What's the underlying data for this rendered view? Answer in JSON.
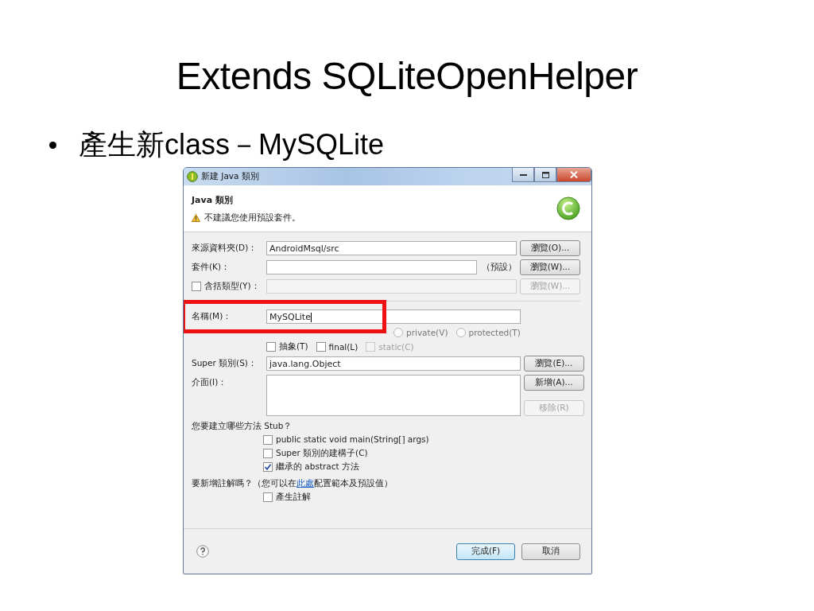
{
  "slide": {
    "title": "Extends SQLiteOpenHelper",
    "bullets": [
      "產生新class－MySQLite"
    ]
  },
  "dialog": {
    "title": "新建 Java 類別",
    "header": {
      "title": "Java 類別",
      "message": "不建議您使用預設套件。"
    },
    "source_folder": {
      "label": "來源資料夾(D)：",
      "value": "AndroidMsql/src",
      "button": {
        "label": "瀏覽(O)...",
        "disabled": false
      }
    },
    "package": {
      "label": "套件(K)：",
      "suffix": "（預設）",
      "button": {
        "label": "瀏覽(W)...",
        "disabled": false
      }
    },
    "enclosing_type": {
      "label": "含括類型(Y)：",
      "checked": false,
      "disabled": true,
      "button": {
        "label": "瀏覽(W)...",
        "disabled": true
      }
    },
    "name": {
      "label": "名稱(M)：",
      "value": "MySQLite",
      "highlighted": true
    },
    "modifier_radios": [
      {
        "label": "private(V)",
        "selected": false
      },
      {
        "label": "protected(T)",
        "selected": false
      }
    ],
    "modifier_checks": [
      {
        "label": "抽象(T)",
        "checked": false,
        "disabled": false
      },
      {
        "label": "final(L)",
        "checked": false,
        "disabled": false
      },
      {
        "label": "static(C)",
        "checked": false,
        "disabled": true
      }
    ],
    "superclass": {
      "label": "Super 類別(S)：",
      "value": "java.lang.Object",
      "button": {
        "label": "瀏覽(E)...",
        "disabled": false
      }
    },
    "interfaces": {
      "label": "介面(I)：",
      "buttons": [
        {
          "label": "新增(A)...",
          "disabled": false
        },
        {
          "label": "移除(R)",
          "disabled": true
        }
      ]
    },
    "stubs": {
      "question": "您要建立哪些方法 Stub？",
      "options": [
        {
          "label": "public static void main(String[] args)",
          "checked": false
        },
        {
          "label": "Super 類別的建構子(C)",
          "checked": false
        },
        {
          "label": "繼承的 abstract 方法",
          "checked": true
        }
      ]
    },
    "comments": {
      "before": "要新增註解嗎？（您可以在",
      "link": "此處",
      "after": "配置範本及預設值）",
      "options": [
        {
          "label": "產生註解",
          "checked": false
        }
      ]
    },
    "footer": {
      "buttons": [
        {
          "label": "完成(F)",
          "default": true
        },
        {
          "label": "取消",
          "default": false
        }
      ]
    }
  }
}
